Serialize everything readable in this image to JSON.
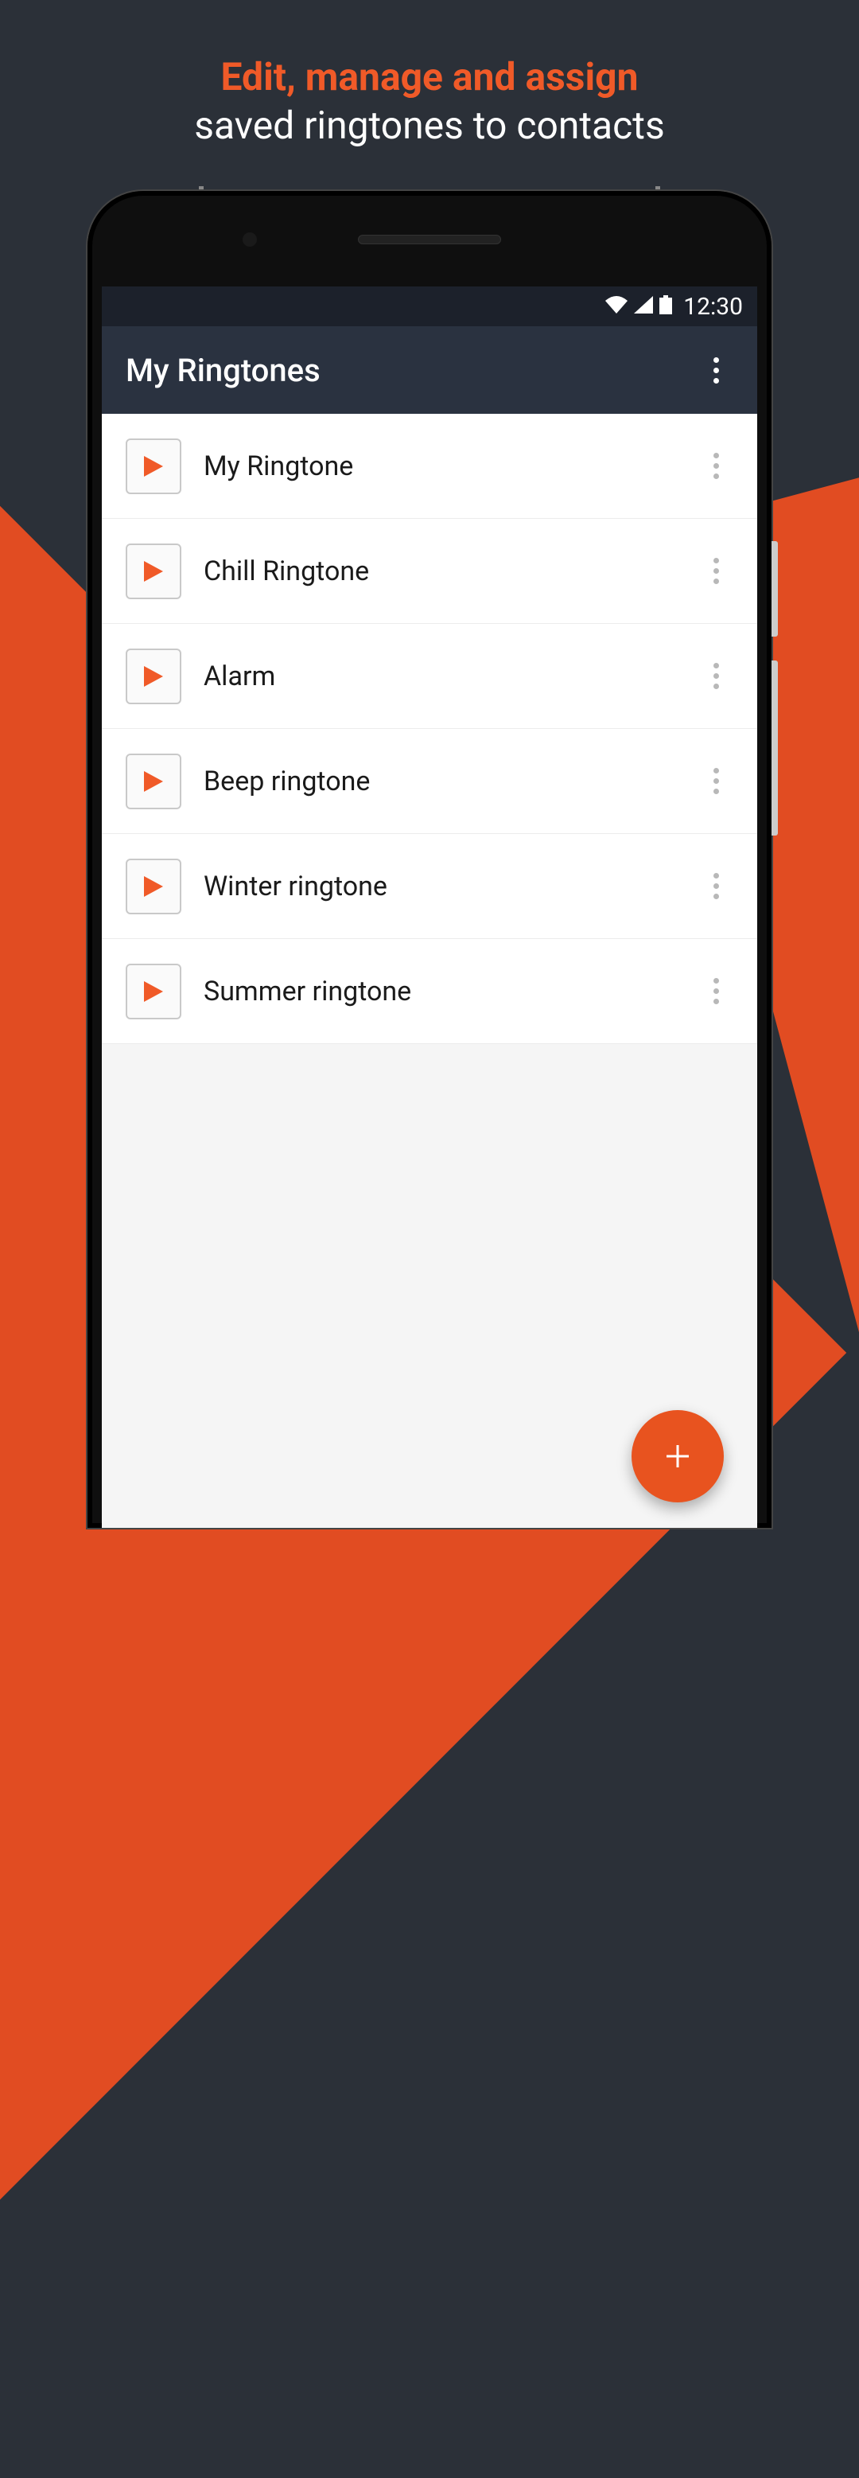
{
  "promo": {
    "line1": "Edit, manage and assign",
    "line2": "saved ringtones to contacts"
  },
  "status": {
    "time": "12:30"
  },
  "appbar": {
    "title": "My Ringtones"
  },
  "ringtones": [
    {
      "name": "My Ringtone"
    },
    {
      "name": "Chill Ringtone"
    },
    {
      "name": "Alarm"
    },
    {
      "name": "Beep ringtone"
    },
    {
      "name": "Winter ringtone"
    },
    {
      "name": "Summer ringtone"
    }
  ],
  "colors": {
    "accent": "#f05a28",
    "fab": "#e8531f",
    "appbar": "#2a3240",
    "statusbar": "#1c212b"
  }
}
